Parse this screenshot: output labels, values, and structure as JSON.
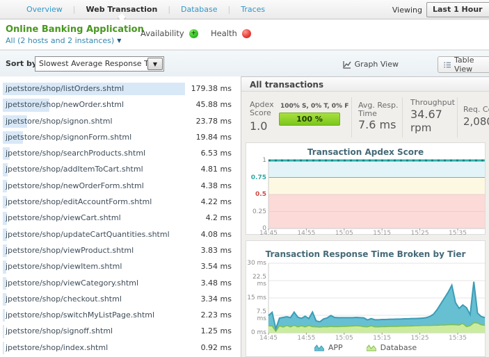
{
  "header": {
    "tabs": [
      {
        "label": "Overview",
        "active": false
      },
      {
        "label": "Web Transaction",
        "active": true
      },
      {
        "label": "Database",
        "active": false
      },
      {
        "label": "Traces",
        "active": false
      }
    ],
    "viewing_label": "Viewing",
    "time_range": "Last 1 Hour"
  },
  "app": {
    "name": "Online Banking Application",
    "scope": "All (2 hosts and 2 instances)",
    "availability_label": "Availability",
    "health_label": "Health"
  },
  "toolbar": {
    "sort_by_label": "Sort by.",
    "sort_value": "Slowest Average Response Time",
    "graph_view_label": "Graph View",
    "table_view_label": "Table View"
  },
  "transactions": {
    "max_ms": 179.38,
    "items": [
      {
        "name": "jpetstore/shop/listOrders.shtml",
        "time": "179.38 ms",
        "ms": 179.38
      },
      {
        "name": "jpetstore/shop/newOrder.shtml",
        "time": "45.88 ms",
        "ms": 45.88
      },
      {
        "name": "jpetstore/shop/signon.shtml",
        "time": "23.78 ms",
        "ms": 23.78
      },
      {
        "name": "jpetstore/shop/signonForm.shtml",
        "time": "19.84 ms",
        "ms": 19.84
      },
      {
        "name": "jpetstore/shop/searchProducts.shtml",
        "time": "6.53 ms",
        "ms": 6.53
      },
      {
        "name": "jpetstore/shop/addItemToCart.shtml",
        "time": "4.81 ms",
        "ms": 4.81
      },
      {
        "name": "jpetstore/shop/newOrderForm.shtml",
        "time": "4.38 ms",
        "ms": 4.38
      },
      {
        "name": "jpetstore/shop/editAccountForm.shtml",
        "time": "4.22 ms",
        "ms": 4.22
      },
      {
        "name": "jpetstore/shop/viewCart.shtml",
        "time": "4.2 ms",
        "ms": 4.2
      },
      {
        "name": "jpetstore/shop/updateCartQuantities.shtml",
        "time": "4.08 ms",
        "ms": 4.08
      },
      {
        "name": "jpetstore/shop/viewProduct.shtml",
        "time": "3.83 ms",
        "ms": 3.83
      },
      {
        "name": "jpetstore/shop/viewItem.shtml",
        "time": "3.54 ms",
        "ms": 3.54
      },
      {
        "name": "jpetstore/shop/viewCategory.shtml",
        "time": "3.48 ms",
        "ms": 3.48
      },
      {
        "name": "jpetstore/shop/checkout.shtml",
        "time": "3.34 ms",
        "ms": 3.34
      },
      {
        "name": "jpetstore/shop/switchMyListPage.shtml",
        "time": "2.23 ms",
        "ms": 2.23
      },
      {
        "name": "jpetstore/shop/signoff.shtml",
        "time": "1.25 ms",
        "ms": 1.25
      },
      {
        "name": "jpetstore/shop/index.shtml",
        "time": "0.92 ms",
        "ms": 0.92
      }
    ]
  },
  "summary": {
    "title": "All transactions",
    "apdex_label": "Apdex Score",
    "apdex_value": "1.0",
    "apdex_breakdown": "100% S, 0% T, 0% F",
    "apdex_bar_text": "100 %",
    "avg_resp_label": "Avg. Resp. Time",
    "avg_resp_value": "7.6 ms",
    "throughput_label": "Throughput",
    "throughput_value": "34.67",
    "throughput_unit": "rpm",
    "req_count_label": "Req. Co",
    "req_count_value": "2,080"
  },
  "chart_data": [
    {
      "type": "line",
      "title": "Transaction Apdex Score",
      "x_ticks": [
        "14:45",
        "14:55",
        "15:05",
        "15:15",
        "15:25",
        "15:35"
      ],
      "y_ticks": [
        {
          "text": "1",
          "color": "#8a8a8a",
          "bold": false
        },
        {
          "text": "0.75",
          "color": "#2fa8a4",
          "bold": true
        },
        {
          "text": "0.5",
          "color": "#cc4a44",
          "bold": true
        },
        {
          "text": "0.25",
          "color": "#8a8a8a",
          "bold": false
        },
        {
          "text": "0",
          "color": "#8a8a8a",
          "bold": false
        }
      ],
      "ylim": [
        0,
        1
      ],
      "grid": true,
      "bands": [
        {
          "name": "satisfied",
          "from": 0.75,
          "to": 1,
          "color": "#e2f4f8",
          "line_color": "#8fd8d8"
        },
        {
          "name": "tolerating",
          "from": 0.5,
          "to": 0.75,
          "color": "#fdf8e2",
          "line_color": "#e8837a"
        },
        {
          "name": "frustrated",
          "from": 0,
          "to": 0.5,
          "color": "#fbdad8",
          "line_color": "#eccfcf"
        }
      ],
      "series": [
        {
          "name": "Apdex Score",
          "color": "#2fb0ad",
          "dash_color": "#17807d",
          "values": [
            1,
            1,
            1,
            1,
            1,
            1,
            1,
            1,
            1,
            1,
            1,
            1,
            1,
            1,
            1,
            1,
            1,
            1,
            1,
            1,
            1,
            1,
            1,
            1,
            1,
            1,
            1,
            1,
            1,
            1,
            1,
            1,
            1,
            1,
            1,
            1,
            1,
            1,
            1,
            1,
            1,
            1,
            1,
            1,
            1,
            1,
            1,
            1,
            1,
            1,
            1,
            1,
            1,
            1,
            1,
            1,
            1,
            1,
            1,
            1
          ]
        }
      ]
    },
    {
      "type": "area",
      "stacked": true,
      "title": "Transaction Response Time Broken by Tier",
      "x_ticks": [
        "14:45",
        "14:55",
        "15:05",
        "15:15",
        "15:25",
        "15:35"
      ],
      "y_ticks": [
        "30 ms",
        "22.5 ms",
        "15 ms",
        "7.5 ms",
        "0 ms"
      ],
      "ylim": [
        0,
        30
      ],
      "grid": true,
      "legend_position": "bottom",
      "series": [
        {
          "name": "Database",
          "fill": "#cbec9f",
          "stroke": "#83bd47",
          "values": [
            3.0,
            2.9,
            0.6,
            3.0,
            2.4,
            3.1,
            2.5,
            3.2,
            2.5,
            3.0,
            2.5,
            3.1,
            2.6,
            2.5,
            2.4,
            2.6,
            2.5,
            2.7,
            2.6,
            2.6,
            2.7,
            2.7,
            2.8,
            2.9,
            3.0,
            2.9,
            2.6,
            2.5,
            3.0,
            2.5,
            2.5,
            2.6,
            2.6,
            2.7,
            2.7,
            2.7,
            2.8,
            2.8,
            2.9,
            2.9,
            3.0,
            3.0,
            3.1,
            3.1,
            3.1,
            3.2,
            3.2,
            3.3,
            3.3,
            3.4,
            3.5,
            3.4,
            3.3,
            4.0,
            2.6,
            3.0,
            4.3,
            4.2,
            3.4,
            3.2
          ]
        },
        {
          "name": "APP",
          "fill": "#66c0d2",
          "stroke": "#3d9cb5",
          "values": [
            4.4,
            5.9,
            1.1,
            3.3,
            4.2,
            3.8,
            4.0,
            5.7,
            4.2,
            3.2,
            4.6,
            3.0,
            6.3,
            2.6,
            2.3,
            3.3,
            3.9,
            4.7,
            4.0,
            3.9,
            3.8,
            3.8,
            3.7,
            3.6,
            3.6,
            3.6,
            3.8,
            3.0,
            3.1,
            3.1,
            3.1,
            3.1,
            3.1,
            3.1,
            3.1,
            3.2,
            3.1,
            3.2,
            3.1,
            3.2,
            3.1,
            3.2,
            3.2,
            3.4,
            3.9,
            4.8,
            6.8,
            9.2,
            11.7,
            14.1,
            17.0,
            9.6,
            7.2,
            8.0,
            8.2,
            4.8,
            17.7,
            4.3,
            3.6,
            3.3
          ]
        }
      ],
      "legend": [
        {
          "label": "APP",
          "fill": "#66c0d2",
          "stroke": "#3d9cb5"
        },
        {
          "label": "Database",
          "fill": "#cbec9f",
          "stroke": "#83bd47"
        }
      ]
    }
  ]
}
